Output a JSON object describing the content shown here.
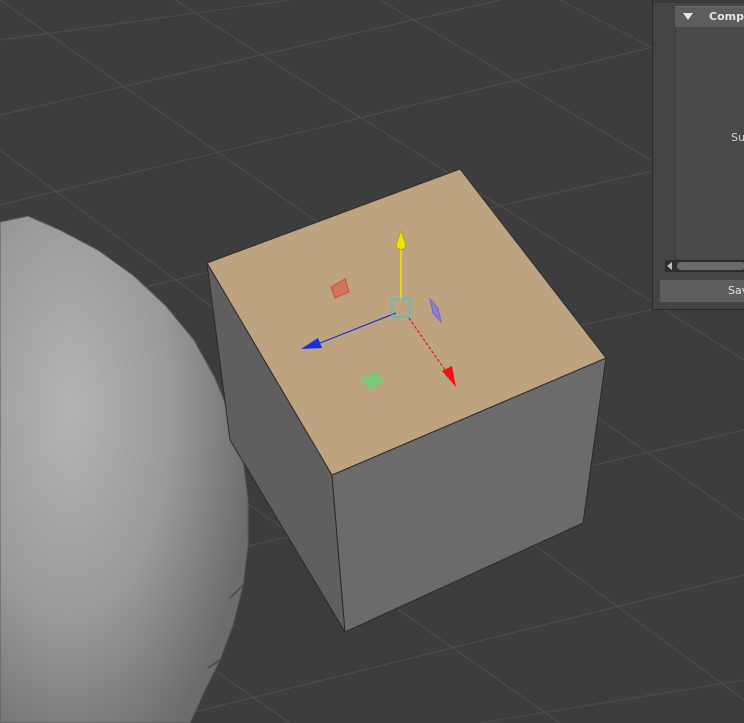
{
  "panel": {
    "section_title": "Compo",
    "body_text": "Su",
    "save_label": "Sav"
  },
  "colors": {
    "background": "#3d3d3d",
    "grid_line": "#4a4a4a",
    "cube_top": "#bda37f",
    "cube_left": "#5f5f5f",
    "cube_right": "#6b6b6b",
    "manip_x": "#ee1111",
    "manip_y": "#f5e400",
    "manip_z": "#1530dd",
    "manip_center": "#39c8d8"
  },
  "icons": {
    "collapse": "triangle-down-icon",
    "scroll_left": "chevron-left-icon"
  }
}
